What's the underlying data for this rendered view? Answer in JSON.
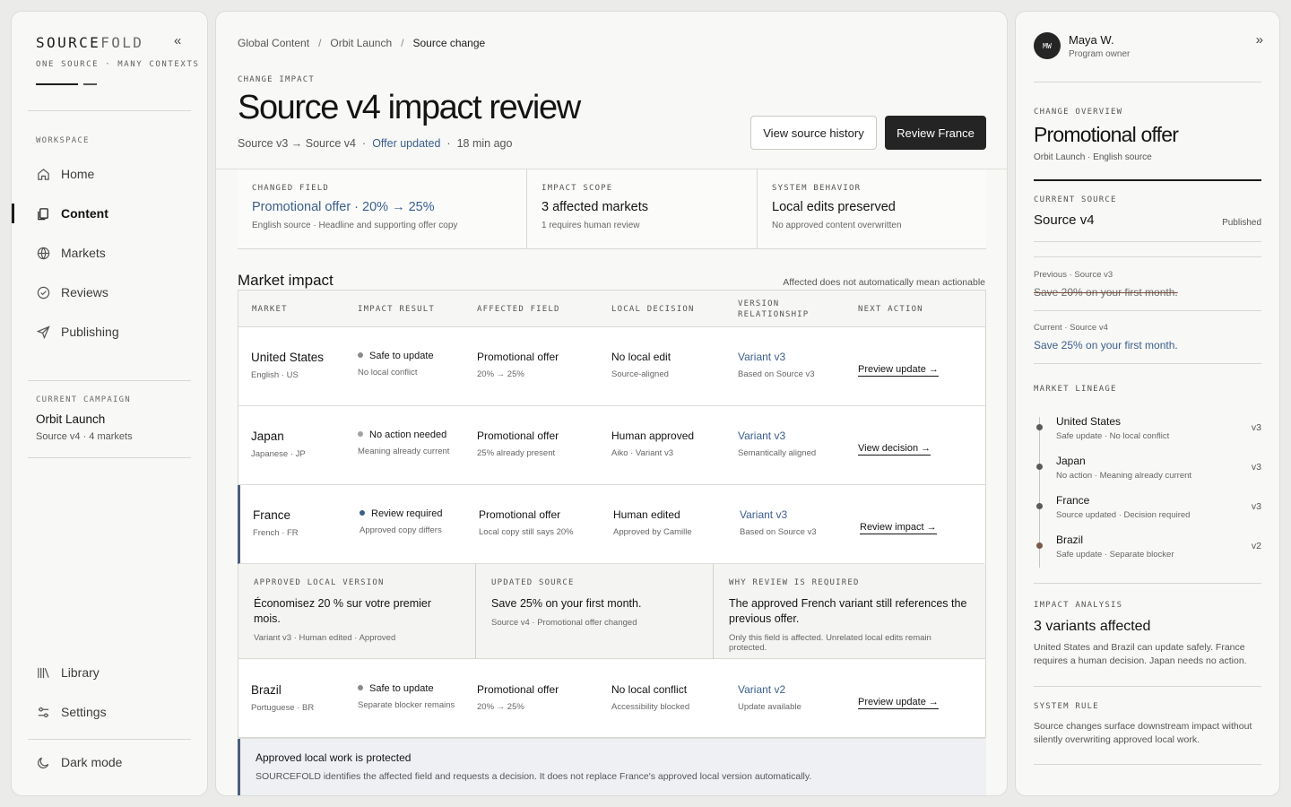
{
  "sidebar": {
    "brand": {
      "bold": "SOURCE",
      "light": "FOLD"
    },
    "tagline": "ONE SOURCE · MANY CONTEXTS",
    "collapse_icon": "chevrons-left-icon",
    "workspace_label": "WORKSPACE",
    "nav": [
      {
        "label": "Home",
        "icon": "home-icon"
      },
      {
        "label": "Content",
        "icon": "documents-icon",
        "active": true
      },
      {
        "label": "Markets",
        "icon": "globe-icon"
      },
      {
        "label": "Reviews",
        "icon": "check-circle-icon"
      },
      {
        "label": "Publishing",
        "icon": "send-icon"
      }
    ],
    "campaign": {
      "label": "CURRENT CAMPAIGN",
      "name": "Orbit Launch",
      "meta": "Source v4 · 4 markets"
    },
    "bottom_nav": [
      {
        "label": "Library",
        "icon": "library-icon"
      },
      {
        "label": "Settings",
        "icon": "sliders-icon"
      }
    ],
    "dark_mode": {
      "label": "Dark mode",
      "icon": "moon-icon"
    }
  },
  "main": {
    "breadcrumbs": [
      "Global Content",
      "Orbit Launch",
      "Source change"
    ],
    "eyebrow": "CHANGE IMPACT",
    "title": "Source v4 impact review",
    "meta": {
      "versions": "Source v3 → Source v4",
      "status": "Offer updated",
      "time": "18 min ago"
    },
    "buttons": {
      "secondary": "View source history",
      "primary": "Review France"
    },
    "stats": [
      {
        "label": "CHANGED FIELD",
        "value": "Promotional offer · 20% → 25%",
        "sub": "English source · Headline and supporting offer copy",
        "accent": true
      },
      {
        "label": "IMPACT SCOPE",
        "value": "3 affected markets",
        "sub": "1 requires human review"
      },
      {
        "label": "SYSTEM BEHAVIOR",
        "value": "Local edits preserved",
        "sub": "No approved content overwritten"
      }
    ],
    "section_title": "Market impact",
    "section_note": "Affected does not automatically mean actionable",
    "table": {
      "headers": [
        "MARKET",
        "IMPACT RESULT",
        "AFFECTED FIELD",
        "LOCAL DECISION",
        "VERSION RELATIONSHIP",
        "NEXT ACTION"
      ],
      "rows": [
        {
          "market": "United States",
          "locale": "English · US",
          "result": "Safe to update",
          "result_sub": "No local conflict",
          "dot": "#8a8a8a",
          "field": "Promotional offer",
          "field_sub": "20% → 25%",
          "decision": "No local edit",
          "decision_sub": "Source-aligned",
          "version": "Variant v3",
          "version_sub": "Based on Source v3",
          "action": "Preview update →"
        },
        {
          "market": "Japan",
          "locale": "Japanese · JP",
          "result": "No action needed",
          "result_sub": "Meaning already current",
          "dot": "#a0a0a0",
          "field": "Promotional offer",
          "field_sub": "25% already present",
          "decision": "Human approved",
          "decision_sub": "Aiko · Variant v3",
          "version": "Variant v3",
          "version_sub": "Semantically aligned",
          "action": "View decision →"
        },
        {
          "market": "France",
          "locale": "French · FR",
          "result": "Review required",
          "result_sub": "Approved copy differs",
          "dot": "#3b5f8c",
          "field": "Promotional offer",
          "field_sub": "Local copy still says 20%",
          "decision": "Human edited",
          "decision_sub": "Approved by Camille",
          "version": "Variant v3",
          "version_sub": "Based on Source v3",
          "action": "Review impact →"
        },
        {
          "market": "Brazil",
          "locale": "Portuguese · BR",
          "result": "Safe to update",
          "result_sub": "Separate blocker remains",
          "dot": "#8a8a8a",
          "field": "Promotional offer",
          "field_sub": "20% → 25%",
          "decision": "No local conflict",
          "decision_sub": "Accessibility blocked",
          "version": "Variant v2",
          "version_sub": "Update available",
          "action": "Preview update →"
        }
      ],
      "detail": [
        {
          "label": "APPROVED LOCAL VERSION",
          "value": "Économisez 20 % sur votre premier mois.",
          "sub": "Variant v3 · Human edited · Approved"
        },
        {
          "label": "UPDATED SOURCE",
          "value": "Save 25% on your first month.",
          "sub": "Source v4 · Promotional offer changed"
        },
        {
          "label": "WHY REVIEW IS REQUIRED",
          "value": "The approved French variant still references the previous offer.",
          "sub": "Only this field is affected. Unrelated local edits remain protected."
        }
      ]
    },
    "notice": {
      "title": "Approved local work is protected",
      "desc": "SOURCEFOLD identifies the affected field and requests a decision. It does not replace France's approved local version automatically."
    }
  },
  "right": {
    "user": {
      "initials": "MW",
      "name": "Maya W.",
      "role": "Program owner"
    },
    "expand_icon": "chevrons-right-icon",
    "overview_label": "CHANGE OVERVIEW",
    "overview_title": "Promotional offer",
    "overview_sub": "Orbit Launch · English source",
    "current_source_label": "CURRENT SOURCE",
    "current_source": "Source v4",
    "current_source_status": "Published",
    "previous_label": "Previous · Source v3",
    "previous_text": "Save 20% on your first month.",
    "current_label": "Current · Source v4",
    "current_text": "Save 25% on your first month.",
    "lineage_label": "MARKET LINEAGE",
    "lineage": [
      {
        "name": "United States",
        "desc": "Safe update · No local conflict",
        "ver": "v3",
        "dot": "#5b5b5b"
      },
      {
        "name": "Japan",
        "desc": "No action · Meaning already current",
        "ver": "v3",
        "dot": "#5b5b5b"
      },
      {
        "name": "France",
        "desc": "Source updated · Decision required",
        "ver": "v3",
        "dot": "#5b5b5b"
      },
      {
        "name": "Brazil",
        "desc": "Safe update · Separate blocker",
        "ver": "v2",
        "dot": "#7a5a4a"
      }
    ],
    "analysis_label": "IMPACT ANALYSIS",
    "analysis_title": "3 variants affected",
    "analysis_text": "United States and Brazil can update safely. France requires a human decision. Japan needs no action.",
    "rule_label": "SYSTEM RULE",
    "rule_text": "Source changes surface downstream impact without silently overwriting approved local work."
  }
}
